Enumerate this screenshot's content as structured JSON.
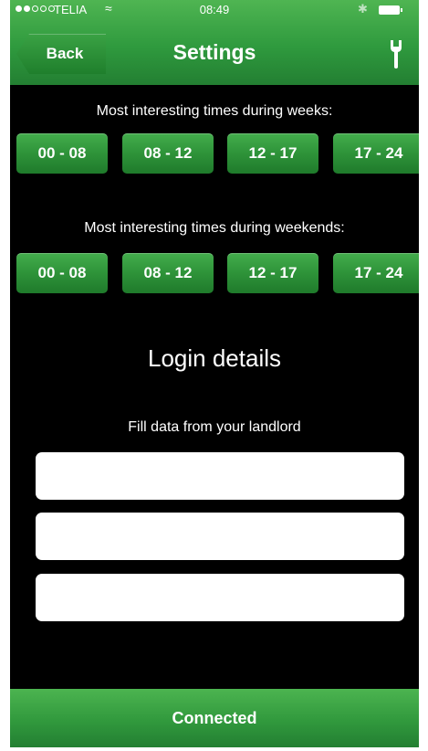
{
  "status_bar": {
    "carrier": "TELIA",
    "time": "08:49",
    "signal_bars_filled": 2,
    "signal_bars_total": 5,
    "wifi_icon": "wifi-icon",
    "bluetooth_icon": "bluetooth-icon",
    "battery_icon": "battery-icon"
  },
  "nav": {
    "back_label": "Back",
    "title": "Settings",
    "tool_icon": "wrench-icon"
  },
  "weeks": {
    "label": "Most interesting times during weeks:",
    "times": [
      "00 - 08",
      "08 - 12",
      "12 - 17",
      "17 - 24"
    ]
  },
  "weekends": {
    "label": "Most interesting times during weekends:",
    "times": [
      "00 - 08",
      "08 - 12",
      "12 - 17",
      "17 - 24"
    ]
  },
  "login": {
    "heading": "Login details",
    "subtitle": "Fill data from your landlord",
    "fields": [
      {
        "value": "",
        "placeholder": ""
      },
      {
        "value": "",
        "placeholder": ""
      },
      {
        "value": "",
        "placeholder": ""
      }
    ]
  },
  "footer": {
    "status": "Connected"
  },
  "colors": {
    "accent_green": "#2f9a3e",
    "background": "#000000",
    "text": "#ffffff"
  }
}
